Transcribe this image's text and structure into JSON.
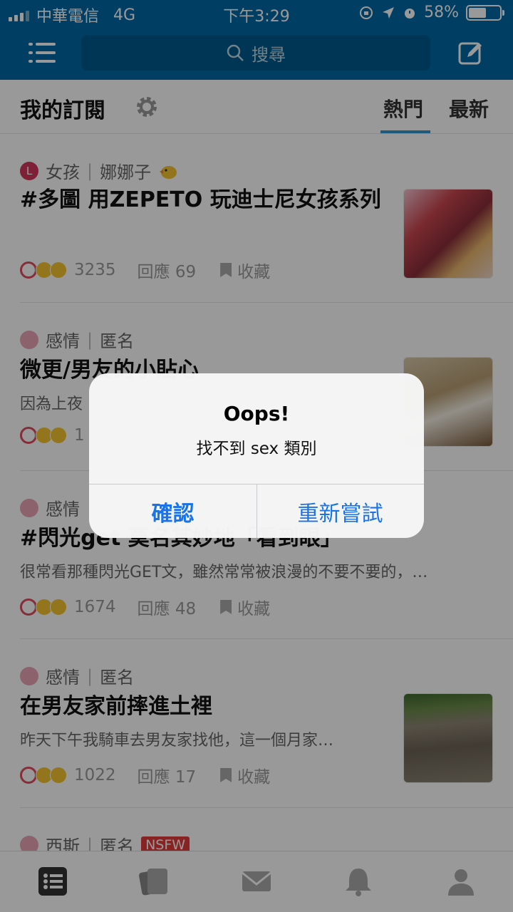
{
  "status_bar": {
    "carrier": "中華電信",
    "network": "4G",
    "time": "下午3:29",
    "battery": "58%",
    "battery_level": 0.58
  },
  "nav": {
    "search_placeholder": "搜尋",
    "icons": [
      "menu-icon",
      "search-icon",
      "edit-icon"
    ]
  },
  "subheader": {
    "title": "我的訂閱",
    "tabs": [
      {
        "label": "熱門",
        "active": true
      },
      {
        "label": "最新",
        "active": false
      }
    ]
  },
  "posts": [
    {
      "avatar_letter": "L",
      "forum": "女孩",
      "author": "娜娜子",
      "title": "#多圖 用ZEPETO 玩迪士尼女孩系列",
      "excerpt": "",
      "reactions": "3235",
      "replies": "回應 69",
      "save": "收藏"
    },
    {
      "forum": "感情",
      "author": "匿名",
      "title": "微更/男友的小貼心",
      "excerpt": "因為上夜",
      "reactions": "1",
      "replies": "",
      "save": ""
    },
    {
      "forum": "感情",
      "author": "",
      "title": "#閃光get 莫名其妙地「看到眼」",
      "excerpt": "很常看那種閃光GET文，雖然常常被浪漫的不要不要的，…",
      "reactions": "1674",
      "replies": "回應 48",
      "save": "收藏"
    },
    {
      "forum": "感情",
      "author": "匿名",
      "title": "在男友家前摔進土裡",
      "excerpt": "昨天下午我騎車去男友家找他，這一個月家…",
      "reactions": "1022",
      "replies": "回應 17",
      "save": "收藏"
    },
    {
      "forum": "西斯",
      "author": "匿名",
      "badge": "NSFW"
    }
  ],
  "alert": {
    "title": "Oops!",
    "message": "找不到 sex 類別",
    "confirm": "確認",
    "retry": "重新嘗試"
  },
  "tabbar_icons": [
    "feed-icon",
    "cards-icon",
    "mail-icon",
    "bell-icon",
    "profile-icon"
  ],
  "colors": {
    "brand": "#006aa6",
    "alert_button": "#1a73e8",
    "nsfw": "#e33b3b"
  }
}
